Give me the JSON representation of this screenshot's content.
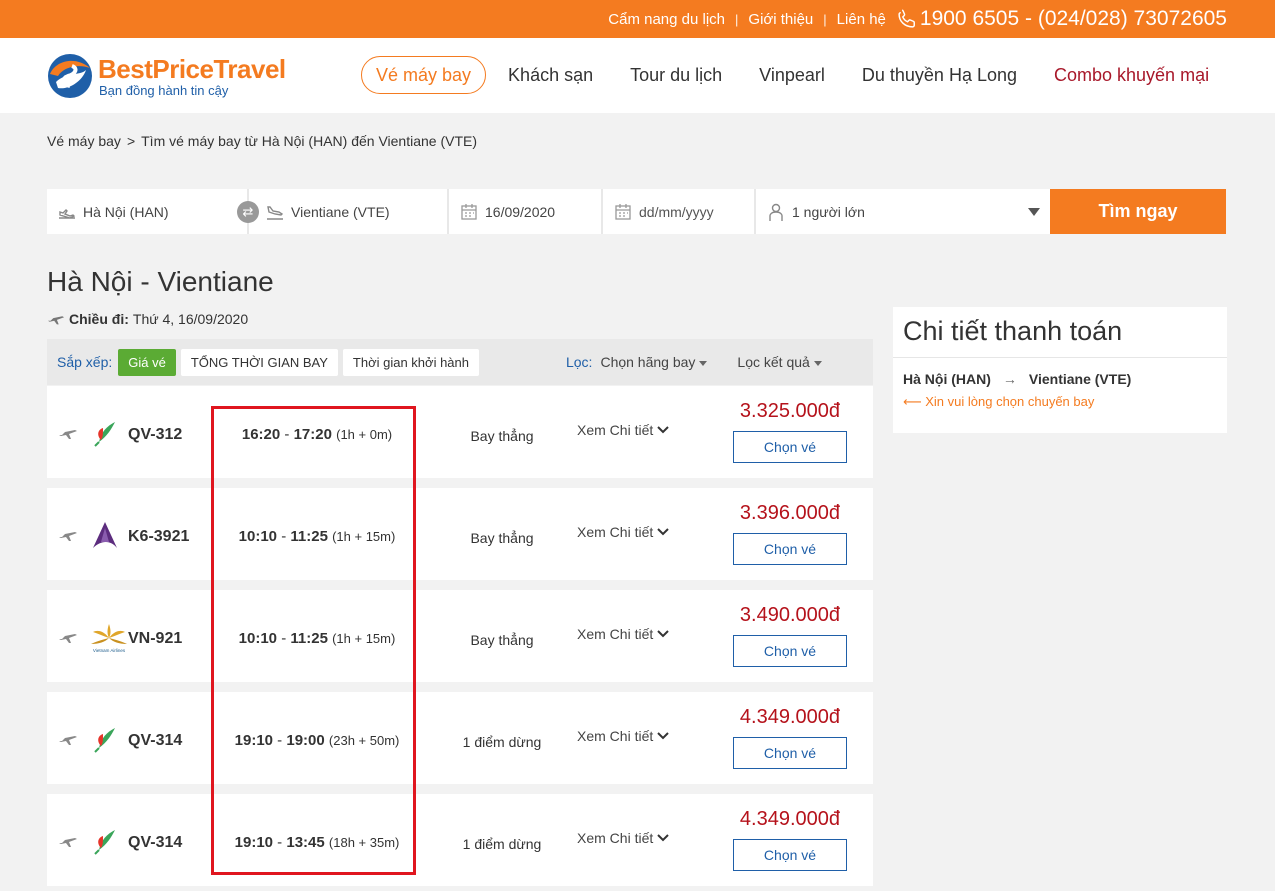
{
  "topbar": {
    "links": [
      "Cẩm nang du lịch",
      "Giới thiệu",
      "Liên hệ"
    ],
    "separator": "|",
    "hotline": "1900 6505 - (024/028) 73072605"
  },
  "header": {
    "logo_title_part1": "BestPrice",
    "logo_title_part2": "Travel",
    "logo_tagline": "Bạn đồng hành tin cậy",
    "nav": [
      "Vé máy bay",
      "Khách sạn",
      "Tour du lịch",
      "Vinpearl",
      "Du thuyền Hạ Long",
      "Combo khuyến mại"
    ]
  },
  "breadcrumb": {
    "home": "Vé máy bay",
    "arrow": ">",
    "current": "Tìm vé máy bay từ Hà Nội (HAN) đến Vientiane (VTE)"
  },
  "search": {
    "from": "Hà Nội (HAN)",
    "to": "Vientiane (VTE)",
    "depart_date": "16/09/2020",
    "return_placeholder": "dd/mm/yyyy",
    "passengers": "1 người lớn",
    "button": "Tìm ngay"
  },
  "route": {
    "title": "Hà Nội - Vientiane",
    "depart_label": "Chiều đi:",
    "depart_value": "Thứ 4, 16/09/2020"
  },
  "sortbar": {
    "sort_label": "Sắp xếp:",
    "sort_options": [
      "Giá vé",
      "TỔNG THỜI GIAN BAY",
      "Thời gian khởi hành"
    ],
    "filter_label": "Lọc:",
    "filter_airline": "Chọn hãng bay",
    "filter_result": "Lọc kết quả"
  },
  "flights": [
    {
      "code": "QV-312",
      "depart": "16:20",
      "arrive": "17:20",
      "duration": "(1h + 0m)",
      "stops": "Bay thẳng",
      "detail": "Xem Chi tiết",
      "price": "3.325.000đ",
      "button": "Chọn vé",
      "airline_icon": "lao-airlines-icon"
    },
    {
      "code": "K6-3921",
      "depart": "10:10",
      "arrive": "11:25",
      "duration": "(1h + 15m)",
      "stops": "Bay thẳng",
      "detail": "Xem Chi tiết",
      "price": "3.396.000đ",
      "button": "Chọn vé",
      "airline_icon": "cambodia-angkor-air-icon"
    },
    {
      "code": "VN-921",
      "depart": "10:10",
      "arrive": "11:25",
      "duration": "(1h + 15m)",
      "stops": "Bay thẳng",
      "detail": "Xem Chi tiết",
      "price": "3.490.000đ",
      "button": "Chọn vé",
      "airline_icon": "vietnam-airlines-icon",
      "airline_text": "Vietnam Airlines"
    },
    {
      "code": "QV-314",
      "depart": "19:10",
      "arrive": "19:00",
      "duration": "(23h + 50m)",
      "stops": "1 điểm dừng",
      "detail": "Xem Chi tiết",
      "price": "4.349.000đ",
      "button": "Chọn vé",
      "airline_icon": "lao-airlines-icon"
    },
    {
      "code": "QV-314",
      "depart": "19:10",
      "arrive": "13:45",
      "duration": "(18h + 35m)",
      "stops": "1 điểm dừng",
      "detail": "Xem Chi tiết",
      "price": "4.349.000đ",
      "button": "Chọn vé",
      "airline_icon": "lao-airlines-icon"
    }
  ],
  "payment": {
    "title": "Chi tiết thanh toán",
    "from": "Hà Nội (HAN)",
    "arrow": "→",
    "to": "Vientiane (VTE)",
    "note": "⟵ Xin vui lòng chọn chuyến bay"
  },
  "colors": {
    "brand_orange": "#f47b20",
    "brand_blue": "#1f5fa8",
    "price_red": "#b5121b",
    "sort_active_green": "#5bab34",
    "highlight_red": "#e0161f"
  }
}
